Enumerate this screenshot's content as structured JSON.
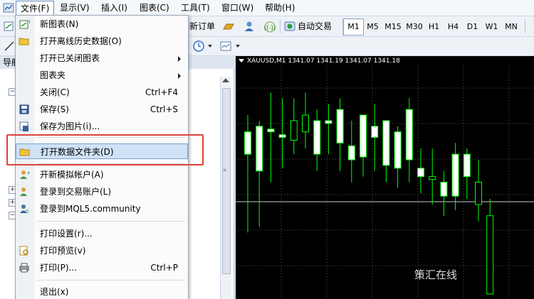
{
  "menubar": {
    "items": [
      {
        "label": "文件(F)"
      },
      {
        "label": "显示(V)"
      },
      {
        "label": "插入(I)"
      },
      {
        "label": "图表(C)"
      },
      {
        "label": "工具(T)"
      },
      {
        "label": "窗口(W)"
      },
      {
        "label": "帮助(H)"
      }
    ]
  },
  "toolbar": {
    "new_order_label": "新订单",
    "auto_trade_label": "自动交易",
    "timeframes": [
      "M1",
      "M5",
      "M15",
      "M30",
      "H1",
      "H4",
      "D1",
      "W1",
      "MN"
    ],
    "selected_timeframe": "M1"
  },
  "navigator": {
    "title": "导航"
  },
  "file_menu": {
    "items": [
      {
        "label": "新图表(N)",
        "shortcut": "",
        "icon": "new-chart-icon"
      },
      {
        "label": "打开离线历史数据(O)",
        "shortcut": "",
        "icon": "open-folder-icon"
      },
      {
        "label": "打开已关闭图表",
        "shortcut": "",
        "icon": ""
      },
      {
        "label": "图表夹",
        "shortcut": "",
        "icon": ""
      },
      {
        "label": "关闭(C)",
        "shortcut": "Ctrl+F4",
        "icon": ""
      },
      {
        "label": "保存(S)",
        "shortcut": "Ctrl+S",
        "icon": "save-icon"
      },
      {
        "label": "保存为图片(i)...",
        "shortcut": "",
        "icon": "save-picture-icon"
      },
      {
        "label": "打开数据文件夹(D)",
        "shortcut": "",
        "icon": "open-folder-icon"
      },
      {
        "label": "开新模拟帐户(A)",
        "shortcut": "",
        "icon": "add-user-icon"
      },
      {
        "label": "登录到交易账户(L)",
        "shortcut": "",
        "icon": "login-user-icon"
      },
      {
        "label": "登录到MQL5.community",
        "shortcut": "",
        "icon": "mql5-login-icon"
      },
      {
        "label": "打印设置(r)...",
        "shortcut": "",
        "icon": ""
      },
      {
        "label": "打印预览(v)",
        "shortcut": "",
        "icon": "print-preview-icon"
      },
      {
        "label": "打印(P)...",
        "shortcut": "Ctrl+P",
        "icon": "printer-icon"
      },
      {
        "label": "退出(x)",
        "shortcut": "",
        "icon": ""
      }
    ],
    "highlighted_index": 7
  },
  "chart": {
    "header": "XAUUSD,M1  1341.07 1341.19 1341.07 1341.18",
    "watermark": "策汇在线",
    "colors": {
      "background": "#000000",
      "bull_body": "#ffffff",
      "wick": "#00ff00",
      "grid": "#555555"
    }
  },
  "chart_data": {
    "type": "candlestick",
    "title": "XAUUSD,M1",
    "last_bar": {
      "open": 1341.07,
      "high": 1341.19,
      "low": 1341.07,
      "close": 1341.18
    },
    "grid": true,
    "candles": [
      {
        "o": 50,
        "h": 64,
        "l": 22,
        "c": 58
      },
      {
        "o": 44,
        "h": 62,
        "l": 24,
        "c": 60
      },
      {
        "o": 58,
        "h": 72,
        "l": 40,
        "c": 59
      },
      {
        "o": 56,
        "h": 70,
        "l": 45,
        "c": 57
      },
      {
        "o": 62,
        "h": 70,
        "l": 50,
        "c": 55
      },
      {
        "o": 64,
        "h": 72,
        "l": 52,
        "c": 58
      },
      {
        "o": 50,
        "h": 66,
        "l": 44,
        "c": 62
      },
      {
        "o": 61,
        "h": 68,
        "l": 50,
        "c": 62
      },
      {
        "o": 54,
        "h": 70,
        "l": 44,
        "c": 66
      },
      {
        "o": 48,
        "h": 62,
        "l": 40,
        "c": 53
      },
      {
        "o": 49,
        "h": 62,
        "l": 42,
        "c": 64
      },
      {
        "o": 56,
        "h": 68,
        "l": 44,
        "c": 60
      },
      {
        "o": 46,
        "h": 62,
        "l": 40,
        "c": 62
      },
      {
        "o": 45,
        "h": 60,
        "l": 38,
        "c": 58
      },
      {
        "o": 48,
        "h": 70,
        "l": 40,
        "c": 66
      },
      {
        "o": 42,
        "h": 52,
        "l": 36,
        "c": 45
      },
      {
        "o": 42,
        "h": 52,
        "l": 32,
        "c": 41
      },
      {
        "o": 35,
        "h": 44,
        "l": 28,
        "c": 40
      },
      {
        "o": 35,
        "h": 54,
        "l": 30,
        "c": 50
      },
      {
        "o": 42,
        "h": 52,
        "l": 34,
        "c": 50
      },
      {
        "o": 40,
        "h": 48,
        "l": 26,
        "c": 32
      },
      {
        "o": 28,
        "h": 34,
        "l": 2,
        "c": 0
      }
    ]
  }
}
